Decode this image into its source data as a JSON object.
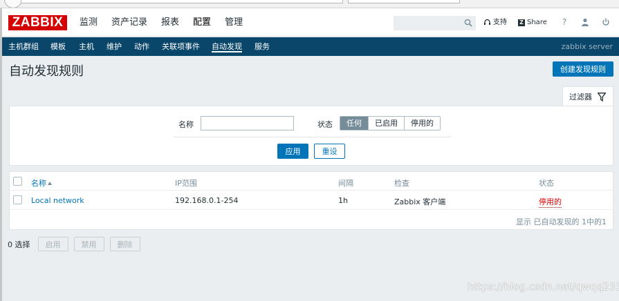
{
  "logo": {
    "text": "ZABBIX",
    "color": "#d40000"
  },
  "top_menu": [
    {
      "label": "监测"
    },
    {
      "label": "资产记录"
    },
    {
      "label": "报表"
    },
    {
      "label": "配置",
      "active": true
    },
    {
      "label": "管理"
    }
  ],
  "header_links": {
    "support_label": "支持",
    "share_label": "Share",
    "help_icon": "question-mark-icon",
    "user_icon": "user-icon",
    "logout_icon": "power-icon"
  },
  "search": {
    "value": "",
    "icon": "search-icon"
  },
  "sub_menu": [
    {
      "label": "主机群组"
    },
    {
      "label": "模板"
    },
    {
      "label": "主机"
    },
    {
      "label": "维护"
    },
    {
      "label": "动作"
    },
    {
      "label": "关联项事件"
    },
    {
      "label": "自动发现",
      "active": true
    },
    {
      "label": "服务"
    }
  ],
  "server_name": "zabbix server",
  "page": {
    "title": "自动发现规则",
    "create_button": "创建发现规则"
  },
  "filter": {
    "tab_label": "过滤器",
    "name_label": "名称",
    "name_value": "",
    "status_label": "状态",
    "status_options": [
      "任何",
      "已启用",
      "停用的"
    ],
    "status_selected": "任何",
    "apply_label": "应用",
    "reset_label": "重设"
  },
  "table": {
    "columns": [
      "名称",
      "IP范围",
      "间隔",
      "检查",
      "状态"
    ],
    "sorted_by": "名称",
    "rows": [
      {
        "name": "Local network",
        "ip_range": "192.168.0.1-254",
        "interval": "1h",
        "checks": "Zabbix 客户端",
        "status": "停用的"
      }
    ],
    "footer": "显示 已自动发现的 1中的1"
  },
  "bulk_actions": {
    "selected_count": "0 选择",
    "enable_label": "启用",
    "disable_label": "禁用",
    "delete_label": "删除"
  },
  "watermark": "https://blog.csdn.net/qwqq233",
  "colors": {
    "nav_bg": "#0a466a",
    "primary": "#0275b8",
    "disabled_status": "#dc0000",
    "selected_option": "#768d99"
  }
}
